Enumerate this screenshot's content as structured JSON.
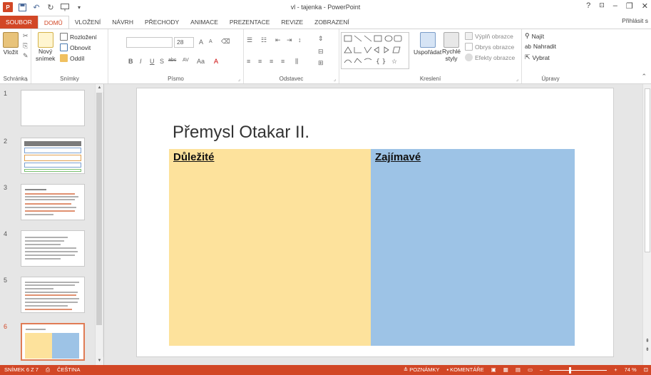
{
  "window": {
    "title": "vl - tajenka - PowerPoint",
    "help": "?",
    "controls": [
      "–",
      "❐",
      "✕"
    ]
  },
  "qat": {
    "app_icon": "P",
    "save_icon": "save-icon",
    "undo_icon": "undo-icon",
    "redo_icon": "redo-icon",
    "present_icon": "present-icon"
  },
  "tabs": [
    "SOUBOR",
    "DOMŮ",
    "VLOŽENÍ",
    "NÁVRH",
    "PŘECHODY",
    "ANIMACE",
    "PREZENTACE",
    "REVIZE",
    "ZOBRAZENÍ"
  ],
  "signin": "Přihlásit s",
  "ribbon": {
    "clipboard": {
      "label": "Schránka",
      "paste": "Vložit"
    },
    "slides": {
      "label": "Snímky",
      "new_slide": "Nový",
      "new_slide2": "snímek",
      "layout": "Rozložení",
      "reset": "Obnovit",
      "section": "Oddíl"
    },
    "font": {
      "label": "Písmo",
      "size": "28",
      "bold": "B",
      "italic": "I",
      "underline": "U",
      "shadow": "S",
      "strike": "abc",
      "spacing": "AV",
      "case": "Aa",
      "color": "A",
      "grow": "A",
      "shrink": "A"
    },
    "paragraph": {
      "label": "Odstavec"
    },
    "drawing": {
      "label": "Kreslení",
      "arrange": "Uspořádat",
      "quick_styles": "Rychlé",
      "quick_styles2": "styly",
      "fill": "Výplň obrazce",
      "outline": "Obrys obrazce",
      "effects": "Efekty obrazce"
    },
    "editing": {
      "label": "Úpravy",
      "find": "Najít",
      "replace": "Nahradit",
      "select": "Vybrat"
    }
  },
  "thumbnails": [
    {
      "num": "1"
    },
    {
      "num": "2"
    },
    {
      "num": "3"
    },
    {
      "num": "4"
    },
    {
      "num": "5"
    },
    {
      "num": "6",
      "selected": true
    }
  ],
  "slide": {
    "title": "Přemysl Otakar II.",
    "left_heading": "Důležité",
    "right_heading": "Zajímavé"
  },
  "status": {
    "slide_info": "SNÍMEK 6 Z 7",
    "language": "ČEŠTINA",
    "notes": "POZNÁMKY",
    "comments": "KOMENTÁŘE",
    "zoom": "74 %",
    "zoom_level": 0.74,
    "minus": "–",
    "plus": "+"
  }
}
